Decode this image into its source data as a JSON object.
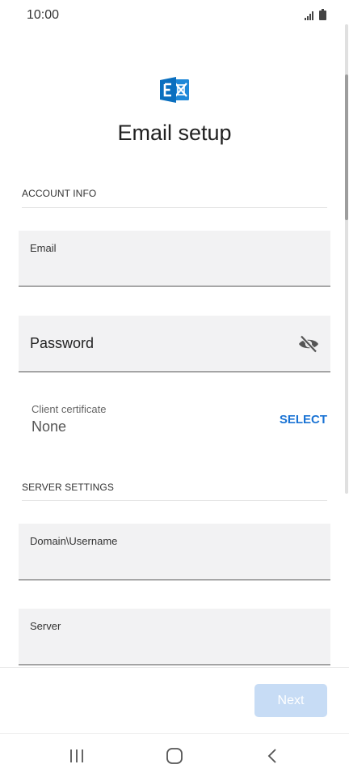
{
  "status_bar": {
    "time": "10:00"
  },
  "header": {
    "title": "Email setup",
    "logo_icon": "exchange-logo-icon"
  },
  "account_info": {
    "section_title": "ACCOUNT INFO",
    "email_label": "Email",
    "email_value": "",
    "password_label": "Password",
    "password_value": "",
    "visibility_icon": "eye-off-icon"
  },
  "client_certificate": {
    "label": "Client certificate",
    "value": "None",
    "select_label": "SELECT"
  },
  "server_settings": {
    "section_title": "SERVER SETTINGS",
    "domain_username_label": "Domain\\Username",
    "server_label": "Server"
  },
  "footer": {
    "next_label": "Next"
  },
  "nav": {
    "recents_icon": "recents-icon",
    "home_icon": "home-icon",
    "back_icon": "back-icon"
  },
  "colors": {
    "accent": "#1a73d4",
    "field_background": "#f2f2f3",
    "next_disabled": "#c7dcf5",
    "exchange_blue": "#0a6fbf"
  }
}
